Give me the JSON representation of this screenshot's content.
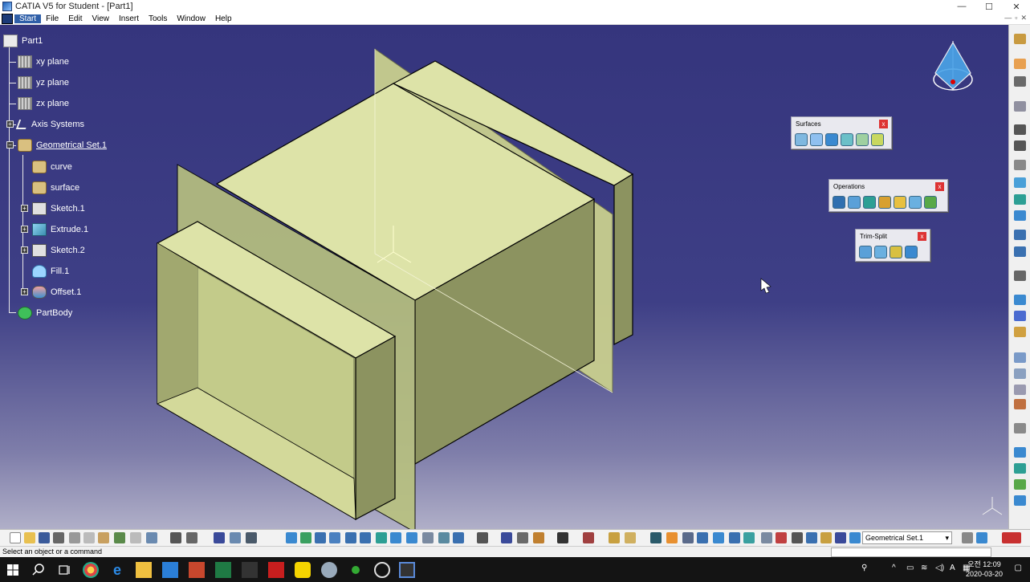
{
  "window": {
    "title": "CATIA V5 for Student - [Part1]",
    "min": "—",
    "max": "☐",
    "close": "✕"
  },
  "menu": {
    "items": [
      "Start",
      "File",
      "Edit",
      "View",
      "Insert",
      "Tools",
      "Window",
      "Help"
    ],
    "mdi_buttons": [
      "—",
      "▫",
      "✕"
    ]
  },
  "tree": {
    "root": "Part1",
    "nodes": [
      {
        "label": "xy plane",
        "icon": "plane-icon"
      },
      {
        "label": "yz plane",
        "icon": "plane-icon"
      },
      {
        "label": "zx plane",
        "icon": "plane-icon"
      },
      {
        "label": "Axis Systems",
        "icon": "axis-icon"
      },
      {
        "label": "Geometrical Set.1",
        "icon": "geometrical-set-icon"
      },
      {
        "label": "curve",
        "icon": "geometrical-set-icon"
      },
      {
        "label": "surface",
        "icon": "geometrical-set-icon"
      },
      {
        "label": "Sketch.1",
        "icon": "sketch-icon"
      },
      {
        "label": "Extrude.1",
        "icon": "extrude-icon"
      },
      {
        "label": "Sketch.2",
        "icon": "sketch-icon"
      },
      {
        "label": "Fill.1",
        "icon": "fill-icon"
      },
      {
        "label": "Offset.1",
        "icon": "offset-icon"
      },
      {
        "label": "PartBody",
        "icon": "partbody-icon"
      }
    ]
  },
  "toolbars": {
    "surfaces": {
      "title": "Surfaces",
      "close": "x"
    },
    "operations": {
      "title": "Operations",
      "close": "x"
    },
    "trim_split": {
      "title": "Trim-Split",
      "close": "x"
    }
  },
  "geo_select": {
    "value": "Geometrical Set.1",
    "arrow": "▾"
  },
  "status": {
    "text": "Select an object or a command"
  },
  "clock": {
    "time": "오전 12:09",
    "date": "2020-03-20"
  },
  "tray": {
    "lang": "A",
    "notif": "▢"
  },
  "colors": {
    "viewport_top": "#35357d",
    "part_face_light": "#dde3a8",
    "part_face_mid": "#b9c27f",
    "part_face_dark": "#8c9360",
    "menu_active": "#2f5fa8"
  }
}
